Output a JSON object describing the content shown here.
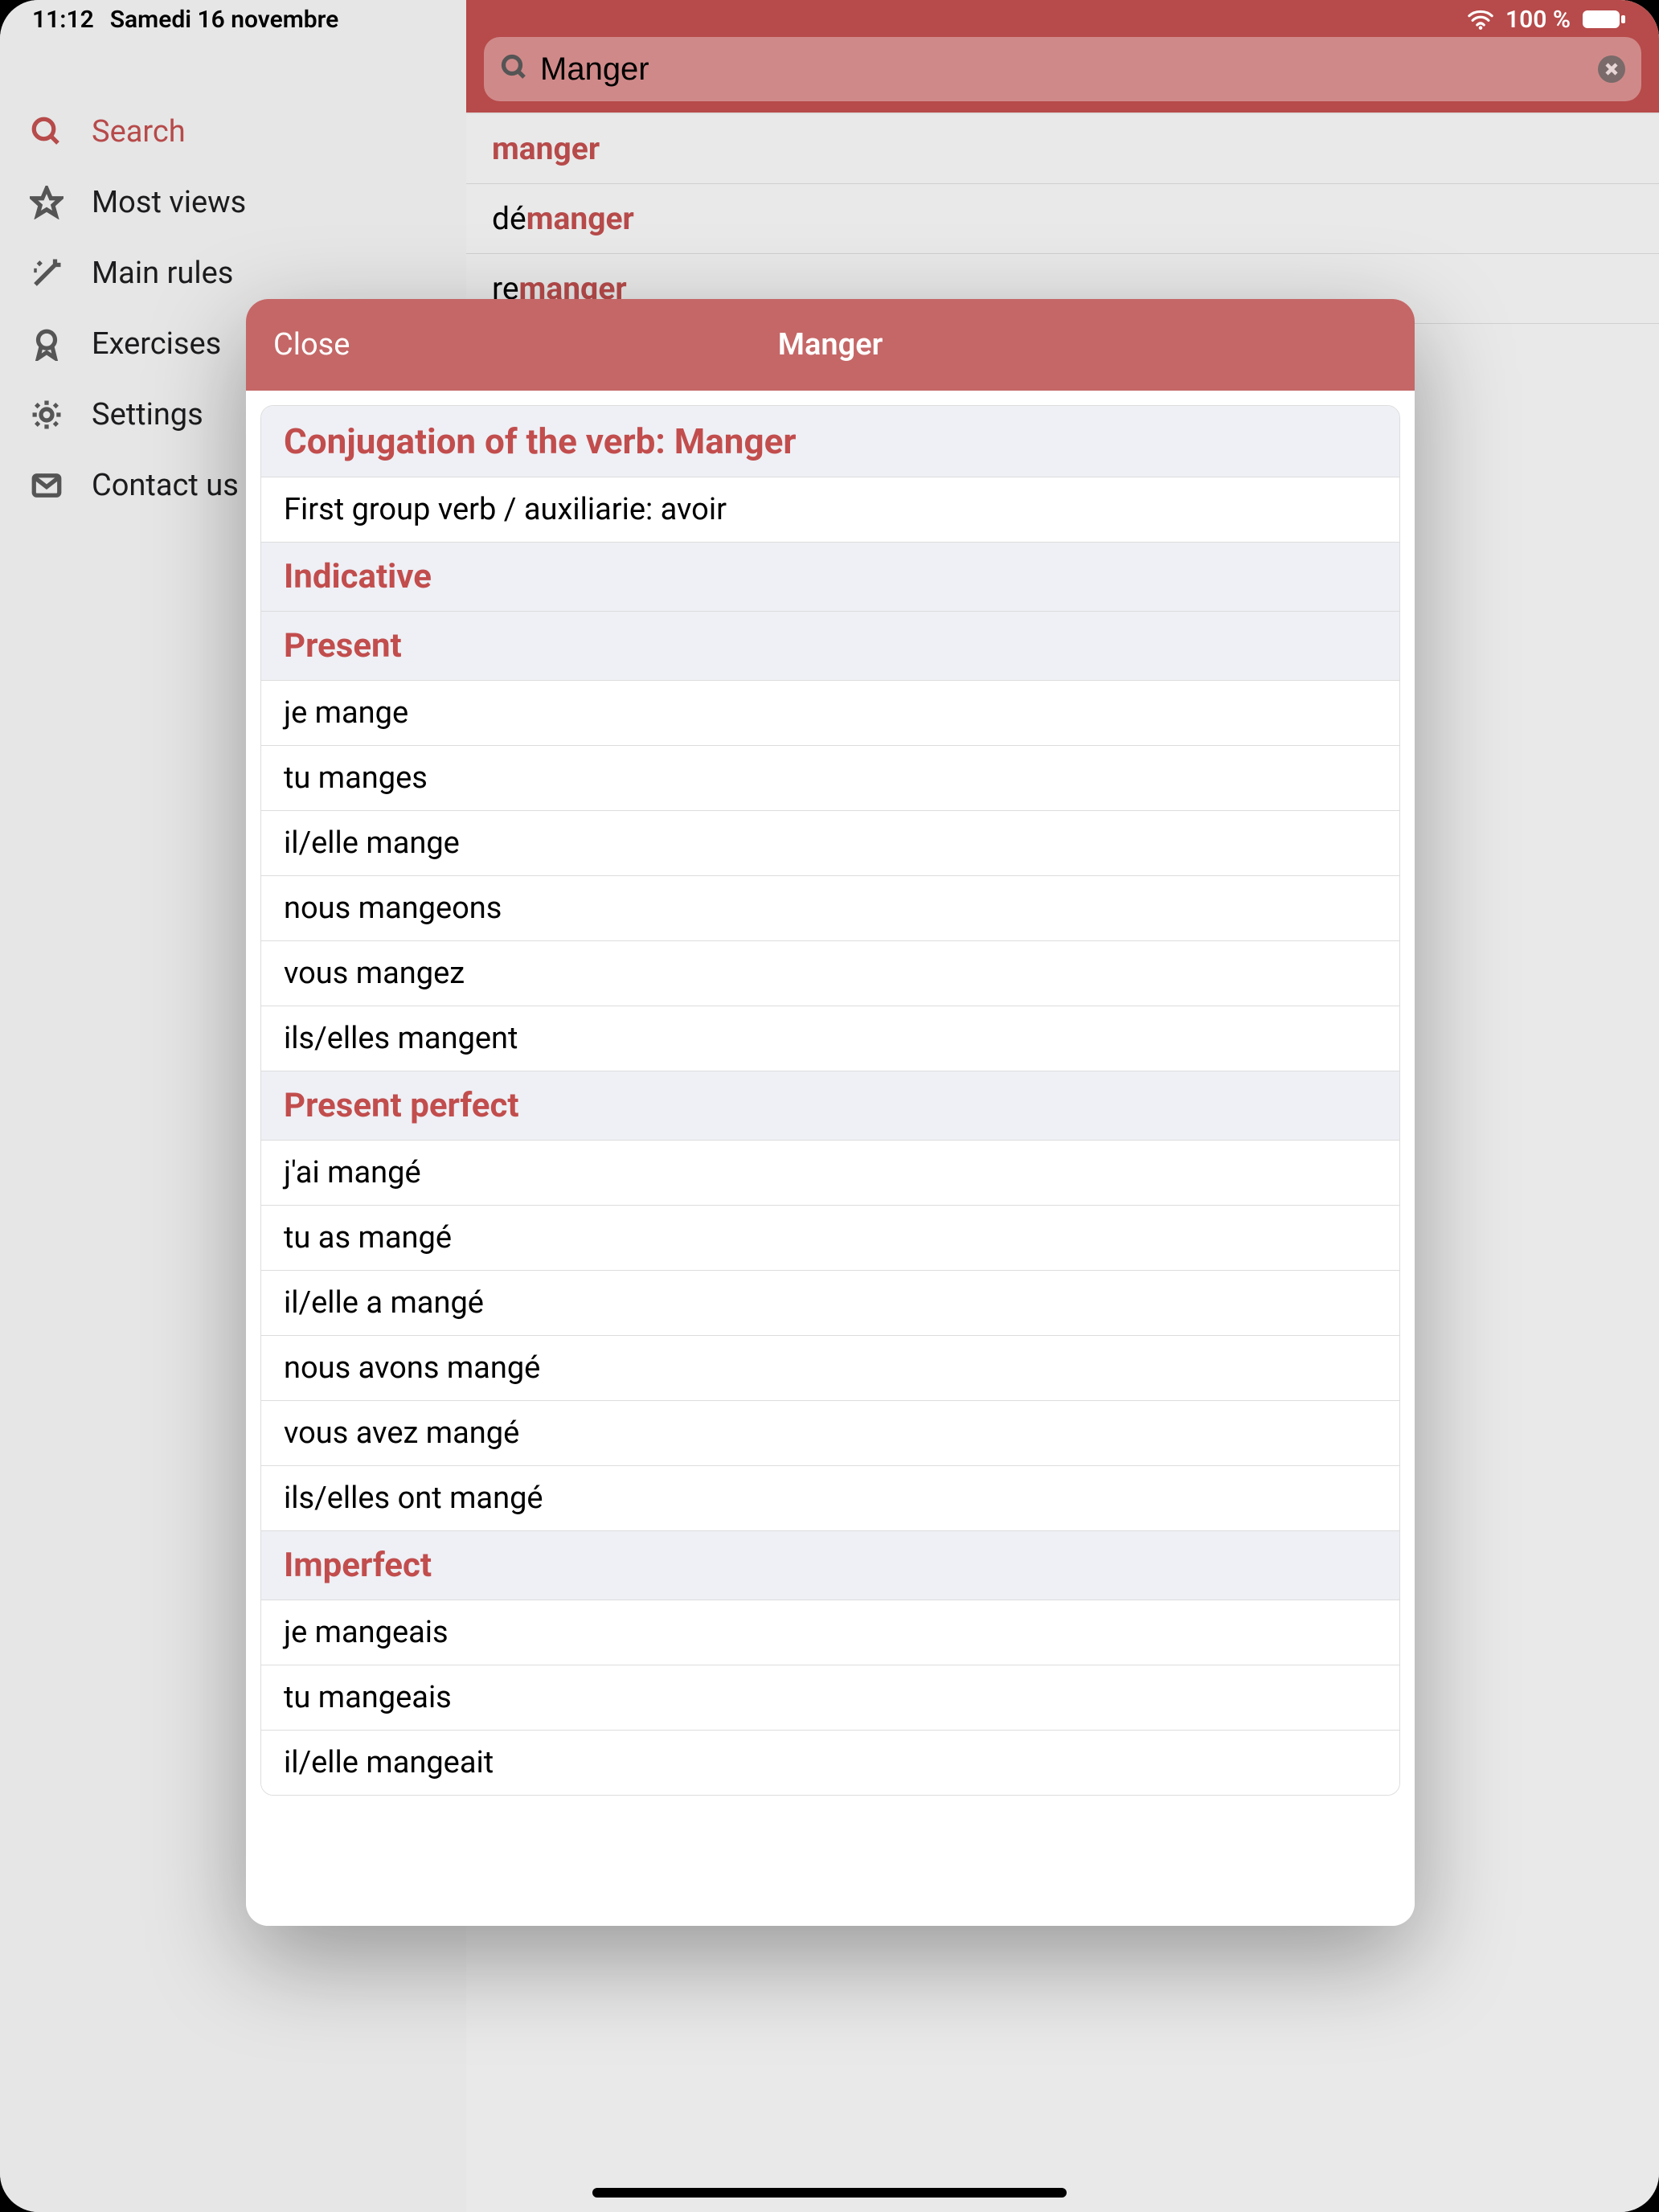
{
  "status": {
    "time": "11:12",
    "date": "Samedi 16 novembre",
    "battery": "100 %"
  },
  "sidebar": {
    "items": [
      {
        "label": "Search",
        "icon": "search",
        "active": true
      },
      {
        "label": "Most views",
        "icon": "star",
        "active": false
      },
      {
        "label": "Main rules",
        "icon": "wand",
        "active": false
      },
      {
        "label": "Exercises",
        "icon": "badge",
        "active": false
      },
      {
        "label": "Settings",
        "icon": "gear",
        "active": false
      },
      {
        "label": "Contact us",
        "icon": "mail",
        "active": false
      }
    ]
  },
  "search": {
    "value": "Manger",
    "results": [
      {
        "prefix": "",
        "match": "manger"
      },
      {
        "prefix": "dé",
        "match": "manger"
      },
      {
        "prefix": "re",
        "match": "manger"
      }
    ]
  },
  "modal": {
    "close": "Close",
    "title": "Manger",
    "heading": "Conjugation of the verb: Manger",
    "subheading": "First group verb / auxiliarie: avoir",
    "sections": [
      {
        "mood": "Indicative",
        "tenses": [
          {
            "name": "Present",
            "rows": [
              "je mange",
              "tu manges",
              "il/elle mange",
              "nous mangeons",
              "vous mangez",
              "ils/elles mangent"
            ]
          },
          {
            "name": "Present perfect",
            "rows": [
              "j'ai mangé",
              "tu as mangé",
              "il/elle a mangé",
              "nous avons mangé",
              "vous avez mangé",
              "ils/elles ont mangé"
            ]
          },
          {
            "name": "Imperfect",
            "rows": [
              "je mangeais",
              "tu mangeais",
              "il/elle mangeait"
            ]
          }
        ]
      }
    ]
  }
}
